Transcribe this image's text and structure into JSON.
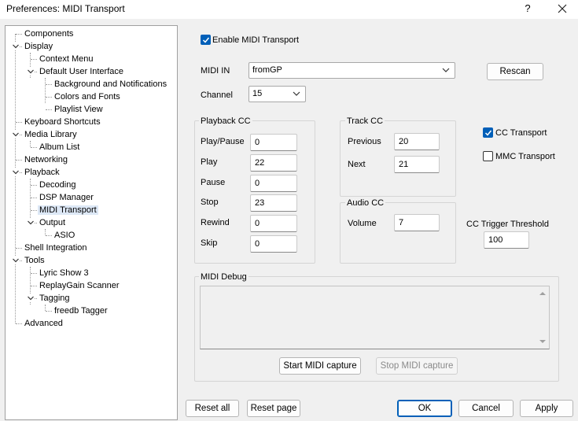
{
  "window": {
    "title": "Preferences: MIDI Transport",
    "help_glyph": "?",
    "close_glyph": "✕"
  },
  "tree": {
    "items": [
      {
        "label": "Components",
        "depth": 0,
        "expander": "none"
      },
      {
        "label": "Display",
        "depth": 0,
        "expander": "expanded"
      },
      {
        "label": "Context Menu",
        "depth": 1,
        "expander": "none"
      },
      {
        "label": "Default User Interface",
        "depth": 1,
        "expander": "expanded"
      },
      {
        "label": "Background and Notifications",
        "depth": 2,
        "expander": "none"
      },
      {
        "label": "Colors and Fonts",
        "depth": 2,
        "expander": "none"
      },
      {
        "label": "Playlist View",
        "depth": 2,
        "expander": "none"
      },
      {
        "label": "Keyboard Shortcuts",
        "depth": 0,
        "expander": "none"
      },
      {
        "label": "Media Library",
        "depth": 0,
        "expander": "expanded"
      },
      {
        "label": "Album List",
        "depth": 1,
        "expander": "none"
      },
      {
        "label": "Networking",
        "depth": 0,
        "expander": "none"
      },
      {
        "label": "Playback",
        "depth": 0,
        "expander": "expanded"
      },
      {
        "label": "Decoding",
        "depth": 1,
        "expander": "none"
      },
      {
        "label": "DSP Manager",
        "depth": 1,
        "expander": "none"
      },
      {
        "label": "MIDI Transport",
        "depth": 1,
        "expander": "none",
        "selected": true
      },
      {
        "label": "Output",
        "depth": 1,
        "expander": "expanded"
      },
      {
        "label": "ASIO",
        "depth": 2,
        "expander": "none"
      },
      {
        "label": "Shell Integration",
        "depth": 0,
        "expander": "none"
      },
      {
        "label": "Tools",
        "depth": 0,
        "expander": "expanded"
      },
      {
        "label": "Lyric Show 3",
        "depth": 1,
        "expander": "none"
      },
      {
        "label": "ReplayGain Scanner",
        "depth": 1,
        "expander": "none"
      },
      {
        "label": "Tagging",
        "depth": 1,
        "expander": "expanded"
      },
      {
        "label": "freedb Tagger",
        "depth": 2,
        "expander": "none"
      },
      {
        "label": "Advanced",
        "depth": 0,
        "expander": "none"
      }
    ]
  },
  "midi": {
    "enable_label": "Enable MIDI Transport",
    "enable_checked": true,
    "midi_in_label": "MIDI IN",
    "midi_in_value": "fromGP",
    "rescan_label": "Rescan",
    "channel_label": "Channel",
    "channel_value": "15"
  },
  "playback_cc": {
    "title": "Playback CC",
    "rows": [
      {
        "label": "Play/Pause",
        "value": "0"
      },
      {
        "label": "Play",
        "value": "22"
      },
      {
        "label": "Pause",
        "value": "0"
      },
      {
        "label": "Stop",
        "value": "23"
      },
      {
        "label": "Rewind",
        "value": "0"
      },
      {
        "label": "Skip",
        "value": "0"
      }
    ]
  },
  "track_cc": {
    "title": "Track CC",
    "rows": [
      {
        "label": "Previous",
        "value": "20"
      },
      {
        "label": "Next",
        "value": "21"
      }
    ]
  },
  "audio_cc": {
    "title": "Audio CC",
    "volume_label": "Volume",
    "volume_value": "7"
  },
  "transport_options": {
    "cc_transport_label": "CC Transport",
    "cc_transport_checked": true,
    "mmc_transport_label": "MMC Transport",
    "mmc_transport_checked": false,
    "threshold_label": "CC Trigger Threshold",
    "threshold_value": "100"
  },
  "debug": {
    "title": "MIDI Debug",
    "log_text": "",
    "start_label": "Start MIDI capture",
    "stop_label": "Stop MIDI capture"
  },
  "footer": {
    "reset_all": "Reset all",
    "reset_page": "Reset page",
    "ok": "OK",
    "cancel": "Cancel",
    "apply": "Apply"
  },
  "colors": {
    "accent": "#005fb8",
    "selection": "#dde8f6",
    "window_bg": "#f0f0f0"
  }
}
